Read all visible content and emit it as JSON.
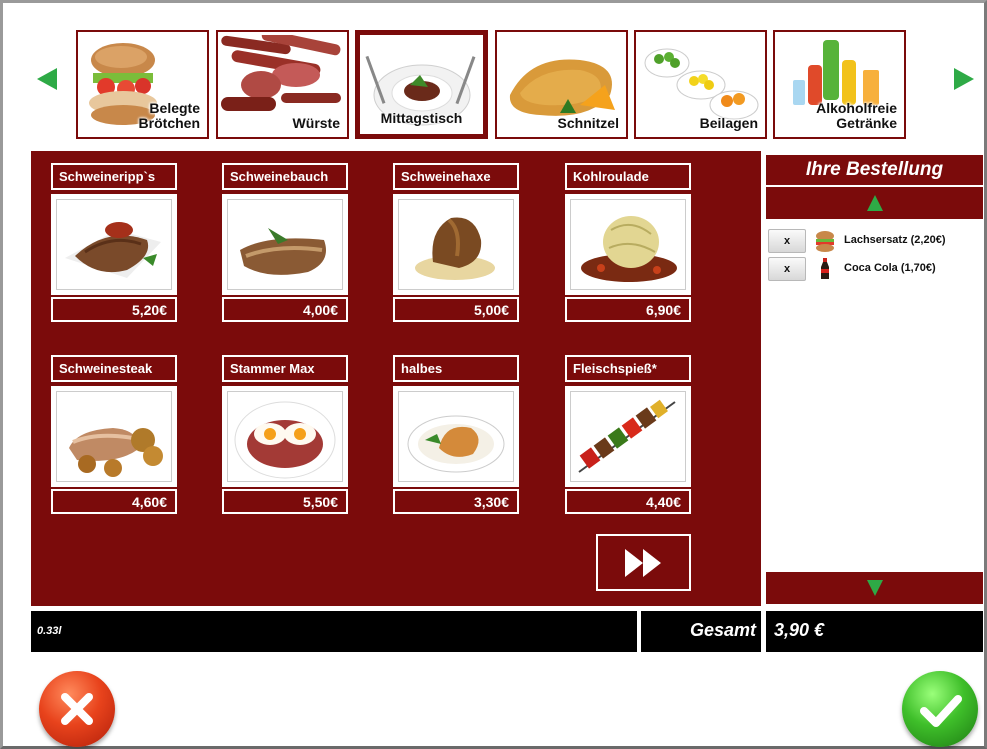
{
  "categories": [
    {
      "label": "Belegte\nBrötchen",
      "active": false
    },
    {
      "label": "Würste",
      "active": false
    },
    {
      "label": "Mittagstisch",
      "active": true
    },
    {
      "label": "Schnitzel",
      "active": false
    },
    {
      "label": "Beilagen",
      "active": false
    },
    {
      "label": "Alkoholfreie\nGetränke",
      "active": false
    }
  ],
  "products": [
    {
      "name": "Schweineripp`s",
      "price": "5,20€"
    },
    {
      "name": "Schweinebauch",
      "price": "4,00€"
    },
    {
      "name": "Schweinehaxe",
      "price": "5,00€"
    },
    {
      "name": "Kohlroulade",
      "price": "6,90€"
    },
    {
      "name": "Schweinesteak",
      "price": "4,60€"
    },
    {
      "name": "Stammer Max",
      "price": "5,50€"
    },
    {
      "name": "halbes",
      "price": "3,30€"
    },
    {
      "name": "Fleischspieß*",
      "price": "4,40€"
    }
  ],
  "order": {
    "title": "Ihre Bestellung",
    "remove_label": "x",
    "items": [
      {
        "text": "Lachsersatz (2,20€)",
        "icon": "sandwich-icon"
      },
      {
        "text": "Coca Cola (1,70€)",
        "icon": "cola-bottle-icon"
      }
    ]
  },
  "footer": {
    "info": "0.33l",
    "total_label": "Gesamt",
    "total_value": "3,90 €"
  },
  "colors": {
    "panel": "#7b0b0b",
    "arrow": "#2eaa46",
    "cancel": "#e8431c",
    "confirm": "#3fbf2a"
  }
}
